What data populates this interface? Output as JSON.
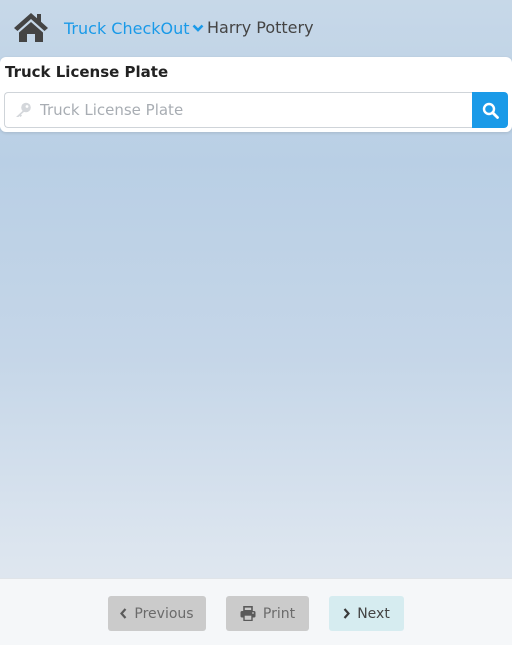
{
  "header": {
    "nav_menu_label": "Truck CheckOut",
    "user_name": "Harry Pottery"
  },
  "panel": {
    "title": "Truck License Plate",
    "search_placeholder": "Truck License Plate",
    "search_value": ""
  },
  "footer": {
    "previous_label": "Previous",
    "print_label": "Print",
    "next_label": "Next"
  },
  "icons": {
    "home": "home-icon",
    "menu_chevron": "chevron-down-icon",
    "key": "key-icon",
    "search": "search-icon",
    "previous": "chevron-left-icon",
    "print": "printer-icon",
    "next": "chevron-right-icon"
  },
  "colors": {
    "accent": "#1a9ae8",
    "disabled_button": "#cbcbcb",
    "next_button": "#d6ecf0"
  }
}
